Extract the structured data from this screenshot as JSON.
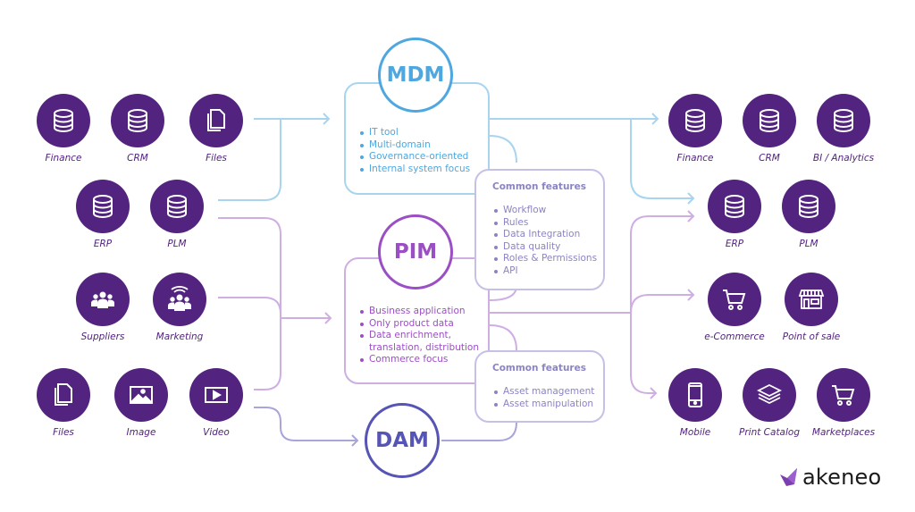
{
  "colors": {
    "node_fill": "#52237f",
    "mdm": "#4ea7df",
    "mdm_line": "#a9d4f0",
    "pim": "#9b4fc4",
    "pim_line": "#cfaee3",
    "dam": "#5654b5",
    "dam_line": "#a8a5db",
    "common_text": "#8a84c4"
  },
  "sources": {
    "row1": [
      {
        "label": "Finance",
        "icon": "database-icon"
      },
      {
        "label": "CRM",
        "icon": "database-icon"
      },
      {
        "label": "Files",
        "icon": "files-icon"
      }
    ],
    "row2": [
      {
        "label": "ERP",
        "icon": "database-icon"
      },
      {
        "label": "PLM",
        "icon": "database-icon"
      }
    ],
    "row3": [
      {
        "label": "Suppliers",
        "icon": "people-icon"
      },
      {
        "label": "Marketing",
        "icon": "broadcast-people-icon"
      }
    ],
    "row4": [
      {
        "label": "Files",
        "icon": "files-icon"
      },
      {
        "label": "Image",
        "icon": "image-icon"
      },
      {
        "label": "Video",
        "icon": "video-icon"
      }
    ]
  },
  "hubs": {
    "mdm": {
      "title": "MDM",
      "bullets": [
        "IT tool",
        "Multi-domain",
        "Governance-oriented",
        "Internal system focus"
      ]
    },
    "pim": {
      "title": "PIM",
      "bullets": [
        "Business application",
        "Only product data",
        "Data enrichment, translation, distribution",
        "Commerce focus"
      ]
    },
    "dam": {
      "title": "DAM"
    }
  },
  "common_features": [
    {
      "title": "Common features",
      "bullets": [
        "Workflow",
        "Rules",
        "Data Integration",
        "Data quality",
        "Roles & Permissions",
        "API"
      ]
    },
    {
      "title": "Common features",
      "bullets": [
        "Asset management",
        "Asset manipulation"
      ]
    }
  ],
  "destinations": {
    "row1": [
      {
        "label": "Finance",
        "icon": "database-icon"
      },
      {
        "label": "CRM",
        "icon": "database-icon"
      },
      {
        "label": "BI / Analytics",
        "icon": "database-icon"
      }
    ],
    "row2": [
      {
        "label": "ERP",
        "icon": "database-icon"
      },
      {
        "label": "PLM",
        "icon": "database-icon"
      }
    ],
    "row3": [
      {
        "label": "e-Commerce",
        "icon": "cart-icon"
      },
      {
        "label": "Point of sale",
        "icon": "store-icon"
      }
    ],
    "row4": [
      {
        "label": "Mobile",
        "icon": "mobile-icon"
      },
      {
        "label": "Print Catalog",
        "icon": "layers-icon"
      },
      {
        "label": "Marketplaces",
        "icon": "cart-icon"
      }
    ]
  },
  "logo": {
    "text": "akeneo"
  }
}
